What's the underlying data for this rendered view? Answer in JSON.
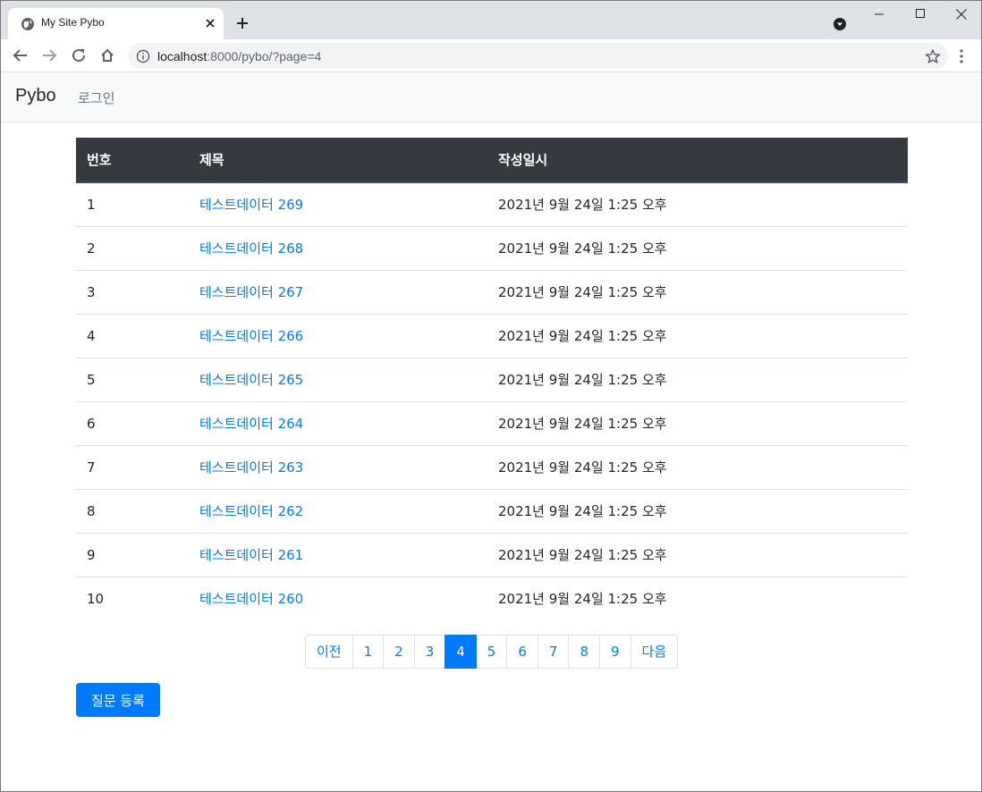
{
  "browser": {
    "tab_title": "My Site Pybo",
    "url_host": "localhost",
    "url_rest": ":8000/pybo/?page=4"
  },
  "navbar": {
    "brand": "Pybo",
    "login": "로그인"
  },
  "table": {
    "headers": [
      "번호",
      "제목",
      "작성일시"
    ],
    "rows": [
      {
        "num": "1",
        "title": "테스트데이터 269",
        "date": "2021년 9월 24일 1:25 오후"
      },
      {
        "num": "2",
        "title": "테스트데이터 268",
        "date": "2021년 9월 24일 1:25 오후"
      },
      {
        "num": "3",
        "title": "테스트데이터 267",
        "date": "2021년 9월 24일 1:25 오후"
      },
      {
        "num": "4",
        "title": "테스트데이터 266",
        "date": "2021년 9월 24일 1:25 오후"
      },
      {
        "num": "5",
        "title": "테스트데이터 265",
        "date": "2021년 9월 24일 1:25 오후"
      },
      {
        "num": "6",
        "title": "테스트데이터 264",
        "date": "2021년 9월 24일 1:25 오후"
      },
      {
        "num": "7",
        "title": "테스트데이터 263",
        "date": "2021년 9월 24일 1:25 오후"
      },
      {
        "num": "8",
        "title": "테스트데이터 262",
        "date": "2021년 9월 24일 1:25 오후"
      },
      {
        "num": "9",
        "title": "테스트데이터 261",
        "date": "2021년 9월 24일 1:25 오후"
      },
      {
        "num": "10",
        "title": "테스트데이터 260",
        "date": "2021년 9월 24일 1:25 오후"
      }
    ]
  },
  "pagination": {
    "prev": "이전",
    "next": "다음",
    "pages": [
      "1",
      "2",
      "3",
      "4",
      "5",
      "6",
      "7",
      "8",
      "9"
    ],
    "current": "4"
  },
  "actions": {
    "ask_question": "질문 등록"
  },
  "colors": {
    "accent": "#007bff",
    "table_header": "#343a40"
  }
}
